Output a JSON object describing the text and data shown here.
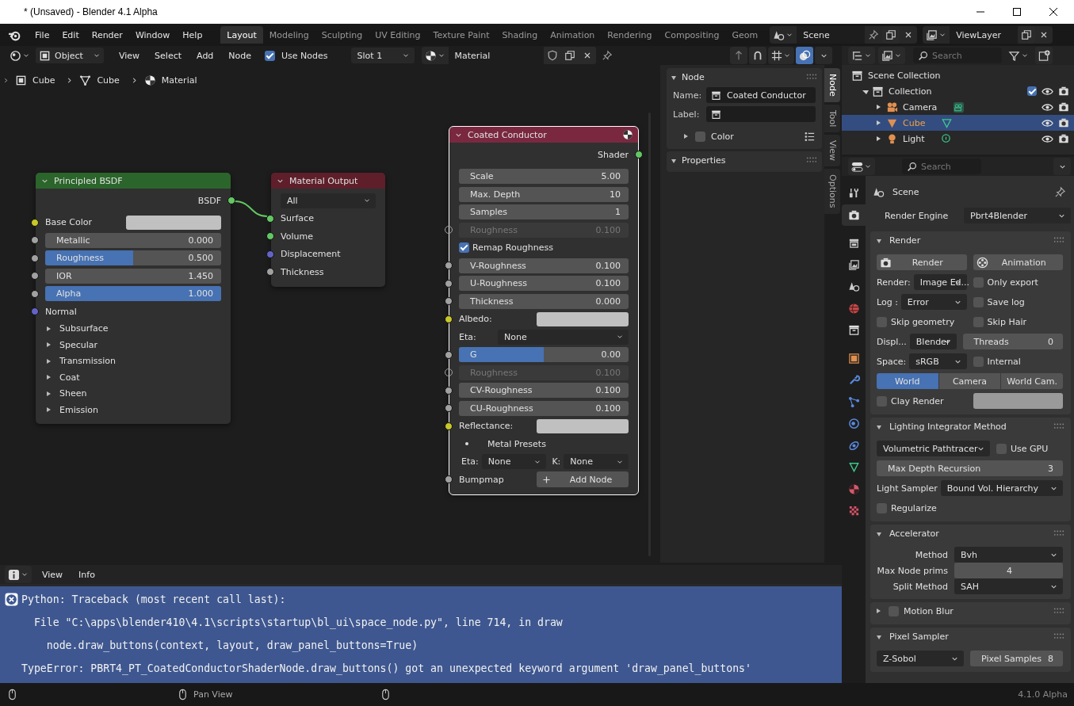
{
  "window": {
    "title": "* (Unsaved) - Blender 4.1 Alpha"
  },
  "menu": [
    "File",
    "Edit",
    "Render",
    "Window",
    "Help"
  ],
  "workspaces": [
    {
      "label": "Layout",
      "selected": true
    },
    {
      "label": "Modeling",
      "selected": false
    },
    {
      "label": "Sculpting",
      "selected": false
    },
    {
      "label": "UV Editing",
      "selected": false
    },
    {
      "label": "Texture Paint",
      "selected": false
    },
    {
      "label": "Shading",
      "selected": false
    },
    {
      "label": "Animation",
      "selected": false
    },
    {
      "label": "Rendering",
      "selected": false
    },
    {
      "label": "Compositing",
      "selected": false
    },
    {
      "label": "Geom",
      "selected": false
    }
  ],
  "scene": {
    "value": "Scene"
  },
  "view_layer": {
    "value": "ViewLayer"
  },
  "node_header": {
    "mode": "Object",
    "menus": [
      "View",
      "Select",
      "Add",
      "Node"
    ],
    "use_nodes": {
      "label": "Use Nodes",
      "checked": true
    },
    "slot": "Slot 1",
    "material": "Material"
  },
  "breadcrumb": [
    "Cube",
    "Cube",
    "Material"
  ],
  "nodes": [
    {
      "title": "Principled BSDF",
      "color": "#2b652b",
      "outputs": [
        {
          "label": "BSDF",
          "color": "#63c763"
        }
      ],
      "rows": [
        {
          "kind": "color",
          "label": "Base Color",
          "color": "#c7c729"
        },
        {
          "kind": "number",
          "label": "Metallic",
          "value": "0.000",
          "color": "#a1a1a1"
        },
        {
          "kind": "slider",
          "label": "Roughness",
          "value": "0.500",
          "level": 0.5,
          "color": "#a1a1a1"
        },
        {
          "kind": "number",
          "label": "IOR",
          "value": "1.450",
          "color": "#a1a1a1"
        },
        {
          "kind": "slider",
          "label": "Alpha",
          "value": "1.000",
          "level": 1,
          "color": "#a1a1a1"
        },
        {
          "kind": "input",
          "label": "Normal",
          "color": "#6363c7"
        },
        {
          "kind": "panel",
          "label": "Subsurface",
          "expanded": false
        },
        {
          "kind": "panel",
          "label": "Specular",
          "expanded": false
        },
        {
          "kind": "panel",
          "label": "Transmission",
          "expanded": false
        },
        {
          "kind": "panel",
          "label": "Coat",
          "expanded": false
        },
        {
          "kind": "panel",
          "label": "Sheen",
          "expanded": false
        },
        {
          "kind": "panel",
          "label": "Emission",
          "expanded": false
        }
      ]
    },
    {
      "title": "Material Output",
      "color": "#5e1f2a",
      "rows": [
        {
          "kind": "dropdown",
          "value": "All"
        },
        {
          "kind": "input",
          "label": "Surface",
          "color": "#63c763"
        },
        {
          "kind": "input",
          "label": "Volume",
          "color": "#63c763"
        },
        {
          "kind": "input",
          "label": "Displacement",
          "color": "#6363c7"
        },
        {
          "kind": "input",
          "label": "Thickness",
          "color": "#a1a1a1"
        }
      ]
    },
    {
      "title": "Coated Conductor",
      "color": "#7a2840",
      "outputs": [
        {
          "label": "Shader",
          "color": "#63c763"
        }
      ],
      "rows": [
        {
          "kind": "number",
          "label": "Scale",
          "value": "5.00",
          "disabled": false
        },
        {
          "kind": "number",
          "label": "Max. Depth",
          "value": "10",
          "disabled": false
        },
        {
          "kind": "number",
          "label": "Samples",
          "value": "1",
          "disabled": false
        },
        {
          "kind": "number",
          "label": "Roughness",
          "value": "0.100",
          "color": "#a1a1a1",
          "disabled": true
        },
        {
          "kind": "checkbox",
          "label": "Remap Roughness",
          "checked": true
        },
        {
          "kind": "number",
          "label": "V-Roughness",
          "value": "0.100",
          "color": "#a1a1a1",
          "disabled": false
        },
        {
          "kind": "number",
          "label": "U-Roughness",
          "value": "0.100",
          "color": "#a1a1a1",
          "disabled": false
        },
        {
          "kind": "number",
          "label": "Thickness",
          "value": "0.000",
          "color": "#a1a1a1",
          "disabled": false
        },
        {
          "kind": "color",
          "label": "Albedo:",
          "color": "#c7c729"
        },
        {
          "kind": "dropdown",
          "label": "Eta:",
          "value": "None"
        },
        {
          "kind": "slider",
          "label": "G",
          "value": "0.00",
          "level": 0.5,
          "color": "#a1a1a1",
          "disabled": false
        },
        {
          "kind": "number",
          "label": "Roughness",
          "value": "0.100",
          "color": "#a1a1a1",
          "disabled": true
        },
        {
          "kind": "number",
          "label": "CV-Roughness",
          "value": "0.100",
          "color": "#a1a1a1",
          "disabled": false
        },
        {
          "kind": "number",
          "label": "CU-Roughness",
          "value": "0.100",
          "color": "#a1a1a1",
          "disabled": false
        },
        {
          "kind": "color",
          "label": "Reflectance:",
          "color": "#c7c729"
        },
        {
          "kind": "bullet",
          "label": "Metal Presets"
        },
        {
          "kind": "dropdown-pair",
          "items": [
            {
              "label": "Eta:",
              "value": "None"
            },
            {
              "label": "K:",
              "value": "None"
            }
          ]
        },
        {
          "kind": "input-button",
          "label": "Bumpmap",
          "color": "#a1a1a1",
          "button": "Add Node"
        }
      ]
    }
  ],
  "sidebar": {
    "tabs": [
      {
        "label": "Node",
        "selected": true
      },
      {
        "label": "Tool",
        "selected": false
      },
      {
        "label": "View",
        "selected": false
      },
      {
        "label": "Options",
        "selected": false
      }
    ],
    "node_panel": {
      "title": "Node",
      "expanded": true,
      "name_label": "Name:",
      "name": "Coated Conductor",
      "label_label": "Label:",
      "color_label": "Color",
      "color_checked": false,
      "color_expanded": false
    },
    "properties_panel": {
      "title": "Properties",
      "expanded": true
    }
  },
  "outliner": {
    "search_placeholder": "Search",
    "tree": [
      {
        "label": "Scene Collection",
        "kind": "scene",
        "children": [
          {
            "label": "Collection",
            "kind": "collection",
            "expanded": true,
            "selected": false,
            "checked": true,
            "children": [
              {
                "label": "Camera",
                "kind": "camera",
                "expanded": false,
                "selected": false
              },
              {
                "label": "Cube",
                "kind": "mesh",
                "expanded": false,
                "selected": true
              },
              {
                "label": "Light",
                "kind": "light",
                "expanded": false,
                "selected": false
              }
            ]
          }
        ]
      }
    ]
  },
  "properties": {
    "search_placeholder": "Search",
    "tabs": [
      {
        "selected": false
      },
      {
        "selected": true
      },
      {
        "selected": false
      },
      {
        "selected": false
      },
      {
        "selected": false
      },
      {
        "selected": false
      },
      {
        "selected": false
      },
      {
        "selected": false
      },
      {
        "selected": false
      },
      {
        "selected": false
      },
      {
        "selected": false
      },
      {
        "selected": false
      },
      {
        "selected": false
      },
      {
        "selected": false
      },
      {
        "selected": false
      }
    ],
    "context": "Scene",
    "render_engine": {
      "label": "Render Engine",
      "value": "Pbrt4Blender"
    },
    "panels": [
      {
        "title": "Render",
        "kind": "grid",
        "expanded": true,
        "rows": [
          [
            {
              "kind": "button",
              "label": "Render"
            },
            {
              "kind": "button",
              "label": "Animation"
            }
          ],
          [
            {
              "kind": "dropdown",
              "label": "Render:",
              "value": "Image Ed..."
            },
            {
              "kind": "checkbox",
              "label": "Only export",
              "checked": false
            }
          ],
          [
            {
              "kind": "dropdown",
              "label": "Log :",
              "value": "Error"
            },
            {
              "kind": "checkbox",
              "label": "Save log",
              "checked": false
            }
          ],
          [
            {
              "kind": "checkbox",
              "label": "Skip geometry",
              "checked": false
            },
            {
              "kind": "checkbox",
              "label": "Skip Hair",
              "checked": false
            }
          ],
          [
            {
              "kind": "dropdown",
              "label": "Displ...",
              "value": "Blender"
            },
            {
              "kind": "number",
              "label": "Threads",
              "value": "0"
            }
          ],
          [
            {
              "kind": "dropdown",
              "label": "Space:",
              "value": "sRGB"
            },
            {
              "kind": "checkbox",
              "label": "Internal",
              "checked": false
            }
          ],
          [
            {
              "kind": "segmented",
              "options": [
                {
                  "label": "World",
                  "selected": true
                },
                {
                  "label": "Camera",
                  "selected": false
                },
                {
                  "label": "World Cam.",
                  "selected": false
                }
              ]
            }
          ],
          [
            {
              "kind": "checkbox",
              "label": "Clay Render",
              "checked": false
            },
            {
              "kind": "swatch"
            }
          ]
        ]
      },
      {
        "title": "Lighting Integrator Method",
        "kind": "grid",
        "expanded": true,
        "rows": [
          [
            {
              "kind": "dropdown",
              "value": "Volumetric Pathtracer"
            },
            {
              "kind": "checkbox",
              "label": "Use GPU",
              "checked": false
            }
          ],
          [
            {
              "kind": "number",
              "label": "Max Depth Recursion",
              "value": "3"
            }
          ],
          [
            {
              "kind": "dropdown",
              "label": "Light Sampler",
              "value": "Bound Vol. Hierarchy"
            }
          ],
          [
            {
              "kind": "checkbox",
              "label": "Regularize",
              "checked": false
            }
          ]
        ]
      },
      {
        "title": "Accelerator",
        "kind": "aligned",
        "expanded": true,
        "rows": [
          [
            {
              "kind": "dropdown",
              "label": "Method",
              "value": "Bvh"
            }
          ],
          [
            {
              "kind": "number",
              "label": "Max Node prims",
              "value": "4"
            }
          ],
          [
            {
              "kind": "dropdown",
              "label": "Split Method",
              "value": "SAH"
            }
          ]
        ]
      },
      {
        "title": "Motion Blur",
        "kind": "grid",
        "expanded": false,
        "checkbox": false
      },
      {
        "title": "Pixel Sampler",
        "kind": "grid",
        "expanded": true,
        "rows": [
          [
            {
              "kind": "dropdown",
              "value": "Z-Sobol"
            },
            {
              "kind": "number",
              "label": "Pixel Samples",
              "value": "8"
            }
          ]
        ]
      }
    ]
  },
  "info": {
    "menus": [
      "View",
      "Info"
    ],
    "reports": [
      {
        "kind": "error",
        "selected": true,
        "lines": [
          "Python: Traceback (most recent call last):",
          "  File \"C:\\apps\\blender410\\4.1\\scripts\\startup\\bl_ui\\space_node.py\", line 714, in draw",
          "    node.draw_buttons(context, layout, draw_panel_buttons=True)",
          "TypeError: PBRT4_PT_CoatedConductorShaderNode.draw_buttons() got an unexpected keyword argument 'draw_panel_buttons'"
        ]
      }
    ]
  },
  "status_bar": {
    "hints": [
      "Pan View"
    ],
    "version": "4.1.0 Alpha"
  }
}
